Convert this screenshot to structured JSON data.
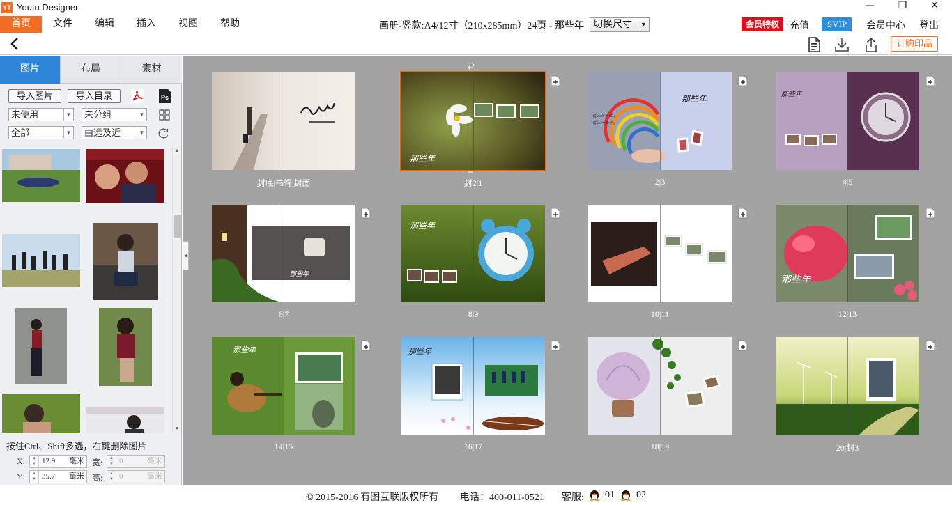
{
  "window": {
    "logo_text": "YT",
    "title": "Youtu Designer",
    "minimize": "—",
    "maximize": "❐",
    "close": "✕"
  },
  "menu": {
    "items": [
      "首页",
      "文件",
      "编辑",
      "插入",
      "视图",
      "帮助"
    ],
    "active_index": 0
  },
  "doc": {
    "info": "画册-竖款:A4/12寸（210x285mm）24页 - 那些年",
    "switch_size": "切换尺寸"
  },
  "account": {
    "vip_privilege": "会员特权",
    "recharge": "充值",
    "svip": "SVIP",
    "member_center": "会员中心",
    "logout": "登出"
  },
  "toolbar": {
    "order_print": "订购印品"
  },
  "left_panel": {
    "tabs": [
      "图片",
      "布局",
      "素材"
    ],
    "active_tab": 0,
    "import_images": "导入图片",
    "import_folder": "导入目录",
    "filter_use": "未使用",
    "filter_group": "未分组",
    "filter_all": "全部",
    "sort_order": "由远及近",
    "hint": "按住Ctrl、Shift多选，右键删除图片",
    "x_label": "X:",
    "x_value": "12.9",
    "y_label": "Y:",
    "y_value": "35.7",
    "width_label": "宽:",
    "width_value": "0",
    "height_label": "高:",
    "height_value": "0",
    "unit": "毫米"
  },
  "spreads": [
    {
      "label": "封底|书脊|封面"
    },
    {
      "label": "封2|1"
    },
    {
      "label": "2|3"
    },
    {
      "label": "4|5"
    },
    {
      "label": "6|7"
    },
    {
      "label": "8|9"
    },
    {
      "label": "10|11"
    },
    {
      "label": "12|13"
    },
    {
      "label": "14|15"
    },
    {
      "label": "16|17"
    },
    {
      "label": "18|19"
    },
    {
      "label": "20|封3"
    }
  ],
  "footer": {
    "copyright": "© 2015-2016 有图互联版权所有",
    "phone": "电话：400-011-0521",
    "service_label": "客服:",
    "service_1": "01",
    "service_2": "02"
  },
  "colors": {
    "accent_orange": "#f26d21",
    "vip_red": "#e0101a",
    "svip_blue": "#2a8fdc",
    "tab_blue": "#2f85d8",
    "canvas_gray": "#a3a3a3"
  }
}
